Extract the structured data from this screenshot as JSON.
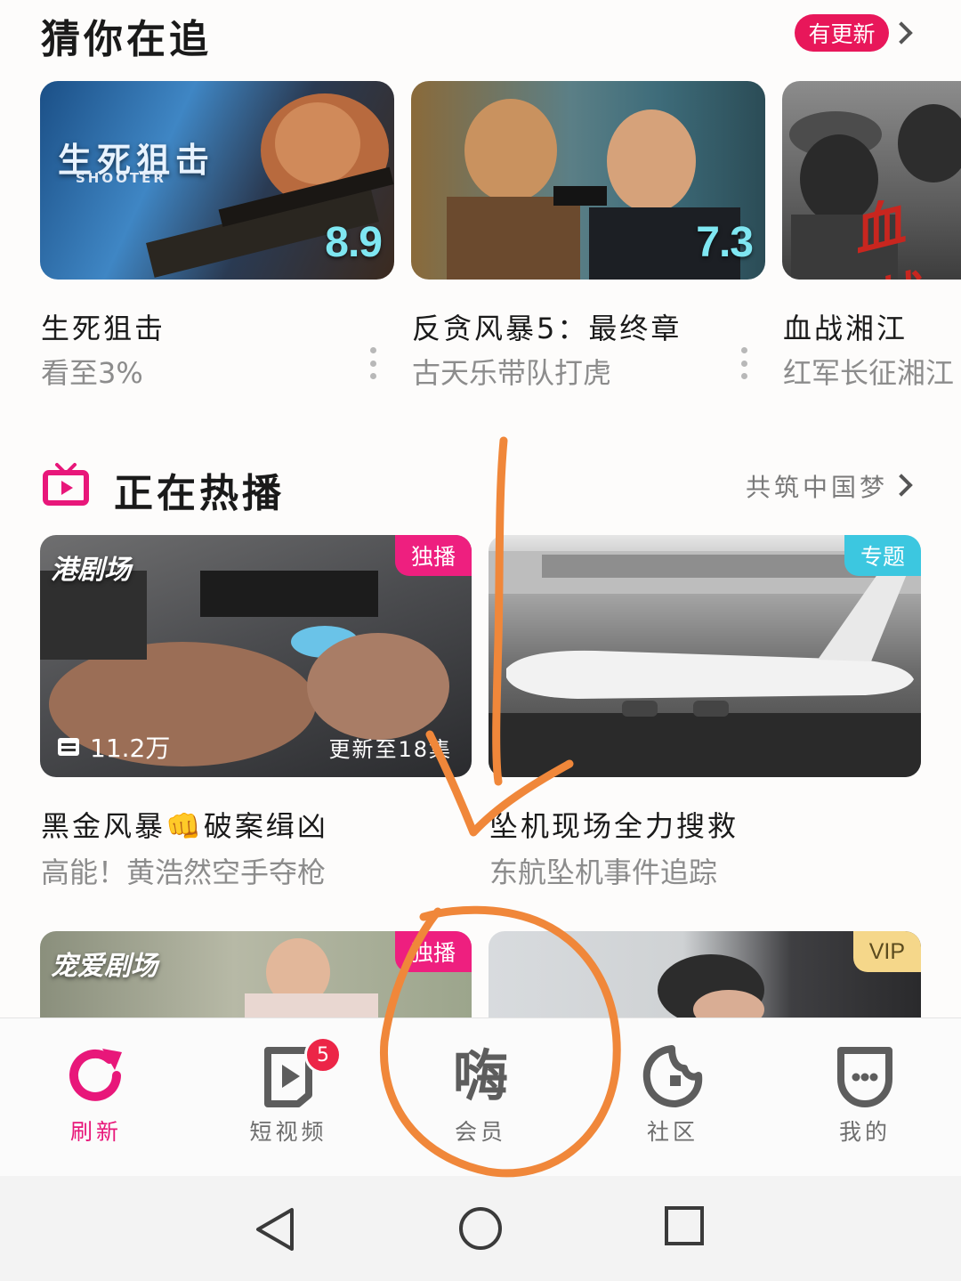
{
  "chase": {
    "title": "猜你在追",
    "badge": "有更新",
    "items": [
      {
        "poster_text": "生死狙击",
        "poster_sub": "SHOOTER",
        "score": "8.9",
        "title": "生死狙击",
        "subtitle": "看至3%"
      },
      {
        "score": "7.3",
        "title": "反贪风暴5：最终章",
        "subtitle": "古天乐带队打虎"
      },
      {
        "poster_text": "血战",
        "title": "血战湘江",
        "subtitle": "红军长征湘江"
      }
    ]
  },
  "hot": {
    "title": "正在热播",
    "more": "共筑中国梦",
    "items": [
      {
        "brand": "港剧场",
        "tag": "独播",
        "views": "11.2万",
        "episode": "更新至18集",
        "title": "黑金风暴👊破案缉凶",
        "subtitle": "高能！黄浩然空手夺枪"
      },
      {
        "tag": "专题",
        "title": "坠机现场全力搜救",
        "subtitle": "东航坠机事件追踪"
      },
      {
        "brand": "宠爱剧场",
        "tag": "独播"
      },
      {
        "tag": "VIP"
      }
    ]
  },
  "nav": {
    "items": [
      {
        "label": "刷新",
        "icon": "refresh-icon",
        "active": true
      },
      {
        "label": "短视频",
        "icon": "play-icon",
        "badge": "5"
      },
      {
        "label": "会员",
        "icon": "member-icon",
        "glyph": "嗨"
      },
      {
        "label": "社区",
        "icon": "community-icon"
      },
      {
        "label": "我的",
        "icon": "profile-icon"
      }
    ]
  },
  "colors": {
    "accent": "#e8177a",
    "badge": "#e8175a",
    "score": "#7fe7f2",
    "annotation": "#f0873a"
  }
}
